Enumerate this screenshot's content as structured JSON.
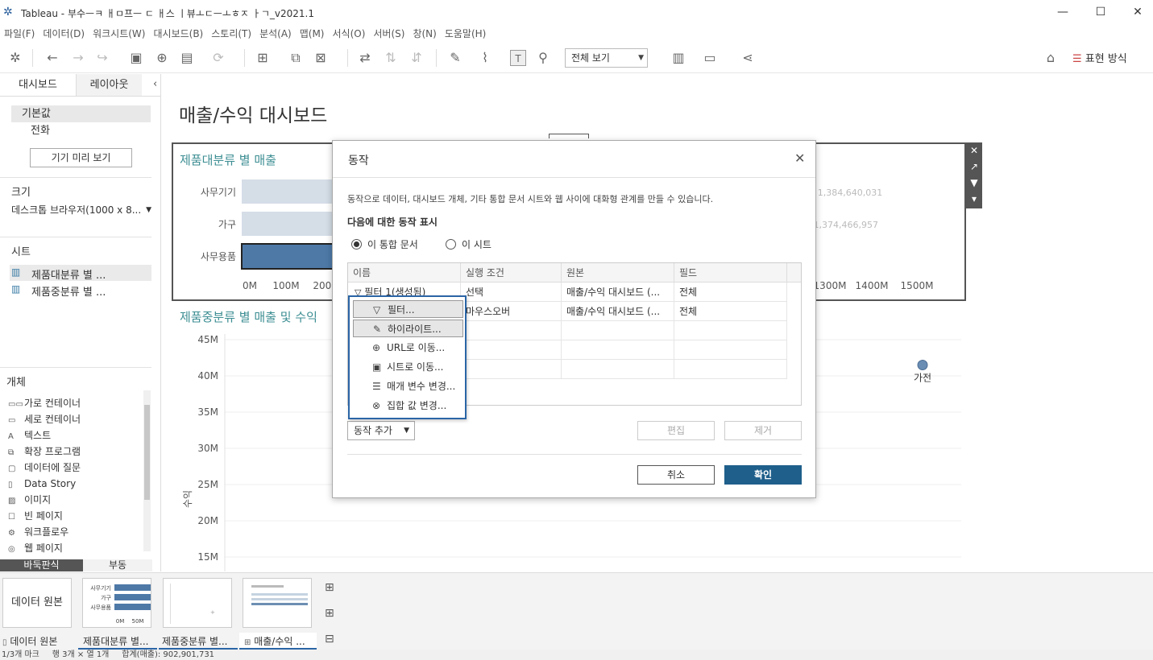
{
  "window": {
    "title": "Tableau - 부수ㅡㅋ ㅐㅁ프ㅡ ㄷ ㅐ스 ㅣ뷰ㅗㄷㅡㅗㅎㅈ ㅏㄱ_v2021.1",
    "minimize": "—",
    "maximize": "☐",
    "close": "✕"
  },
  "menubar": [
    "파일(F)",
    "데이터(D)",
    "워크시트(W)",
    "대시보드(B)",
    "스토리(T)",
    "분석(A)",
    "맵(M)",
    "서식(O)",
    "서버(S)",
    "창(N)",
    "도움말(H)"
  ],
  "toolbar": {
    "view_select": "전체 보기",
    "show_me": "표현 방식"
  },
  "left_panel": {
    "tabs": [
      "대시보드",
      "레이아웃"
    ],
    "devices": [
      "기본값",
      "전화"
    ],
    "preview_button": "기기 미리 보기",
    "size_heading": "크기",
    "size_value": "데스크톱 브라우저(1000 x 8...",
    "sheets_heading": "시트",
    "sheets": [
      "제품대분류 별 ...",
      "제품중분류 별 ..."
    ],
    "objects_heading": "개체",
    "objects": [
      {
        "icon": "horizontal-container-icon",
        "glyph": "▭▭",
        "label": "가로 컨테이너"
      },
      {
        "icon": "vertical-container-icon",
        "glyph": "▭",
        "label": "세로 컨테이너"
      },
      {
        "icon": "text-icon",
        "glyph": "A",
        "label": "텍스트"
      },
      {
        "icon": "extension-icon",
        "glyph": "⧉",
        "label": "확장 프로그램"
      },
      {
        "icon": "ask-data-icon",
        "glyph": "▢",
        "label": "데이터에 질문"
      },
      {
        "icon": "data-story-icon",
        "glyph": "▯",
        "label": "Data Story"
      },
      {
        "icon": "image-icon",
        "glyph": "▨",
        "label": "이미지"
      },
      {
        "icon": "blank-icon",
        "glyph": "☐",
        "label": "빈 페이지"
      },
      {
        "icon": "workflow-icon",
        "glyph": "⚙",
        "label": "워크플로우"
      },
      {
        "icon": "web-page-icon",
        "glyph": "◎",
        "label": "웹 페이지"
      }
    ],
    "bottom_tabs": [
      "바둑판식",
      "부동"
    ]
  },
  "dashboard": {
    "title": "매출/수익 대시보드",
    "chart1_title": "제품대분류 별 매출",
    "chart2_title": "제품중분류 별 매출 및 수익"
  },
  "chart_data": [
    {
      "type": "bar",
      "title": "제품대분류 별 매출",
      "categories": [
        "사무기기",
        "가구",
        "사무용품"
      ],
      "values": [
        1384640031,
        1374466957,
        null
      ],
      "data_labels": [
        "1,384,640,031",
        "1,374,466,957",
        ""
      ],
      "x_ticks": [
        "0M",
        "100M",
        "200M",
        "1300M",
        "1400M",
        "1500M"
      ],
      "xlim": [
        0,
        1500000000
      ]
    },
    {
      "type": "scatter",
      "title": "제품중분류 별 매출 및 수익",
      "ylabel": "수익",
      "y_ticks": [
        "45M",
        "40M",
        "35M",
        "30M",
        "25M",
        "20M",
        "15M"
      ],
      "points": [
        {
          "label": "가전",
          "y": 41500000
        }
      ]
    }
  ],
  "dialog": {
    "title": "동작",
    "description": "동작으로 데이터, 대시보드 개체, 기타 통합 문서 시트와 웹 사이에 대화형 관계를 만들 수 있습니다.",
    "show_for_label": "다음에 대한 동작 표시",
    "radio_workbook": "이 통합 문서",
    "radio_sheet": "이 시트",
    "columns": [
      "이름",
      "실행 조건",
      "원본",
      "필드"
    ],
    "rows": [
      {
        "name": "필터 1(생성됨)",
        "run_on": "선택",
        "source": "매출/수익 대시보드 (...",
        "field": "전체"
      },
      {
        "name": "",
        "run_on": "마우스오버",
        "source": "매출/수익 대시보드 (...",
        "field": "전체"
      }
    ],
    "add_action": "동작 추가",
    "edit": "편집",
    "remove": "제거",
    "cancel": "취소",
    "ok": "확인"
  },
  "add_menu": [
    {
      "icon": "filter-icon",
      "glyph": "▽",
      "label": "필터..."
    },
    {
      "icon": "highlight-icon",
      "glyph": "✎",
      "label": "하이라이트..."
    },
    {
      "icon": "globe-icon",
      "glyph": "⊕",
      "label": "URL로 이동..."
    },
    {
      "icon": "sheet-nav-icon",
      "glyph": "▣",
      "label": "시트로 이동..."
    },
    {
      "icon": "parameter-icon",
      "glyph": "☰",
      "label": "매개 변수 변경..."
    },
    {
      "icon": "set-icon",
      "glyph": "⊗",
      "label": "집합 값 변경..."
    }
  ],
  "sheet_tabs": [
    {
      "label": "데이터 원본"
    },
    {
      "label": "제품대분류 별..."
    },
    {
      "label": "제품중분류 별..."
    },
    {
      "label": "매출/수익 ..."
    }
  ],
  "data_source_thumb": "데이터 원본",
  "thumb1_labels": [
    "사무기기",
    "가구",
    "사무용품"
  ],
  "thumb1_ticks": [
    "0M",
    "50M"
  ],
  "status": "1/3개 마크     행 3개 × 열 1개     합계(매출): 902,901,731"
}
